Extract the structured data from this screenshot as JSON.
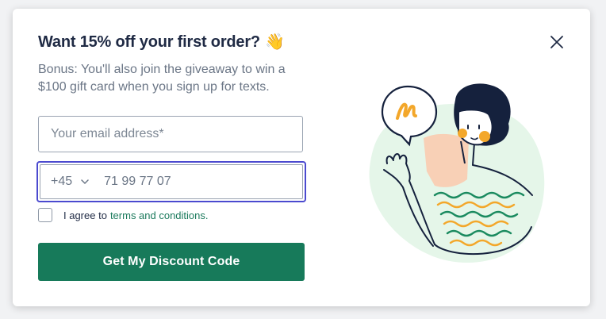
{
  "modal": {
    "title": "Want 15% off your first order?",
    "title_emoji": "👋",
    "subtitle": "Bonus: You'll also join the giveaway to win a $100 gift card when you sign up for texts.",
    "close_icon": "close-icon"
  },
  "form": {
    "email_placeholder": "Your email address*",
    "country_code": "+45",
    "phone_value": "71 99 77 07",
    "consent_prefix": "I agree to",
    "consent_link": "terms and conditions.",
    "submit_label": "Get My Discount Code"
  },
  "colors": {
    "accent": "#177a5a",
    "focus_border": "#4b4acf",
    "title": "#1f2a44",
    "text_muted": "#6b7686"
  }
}
